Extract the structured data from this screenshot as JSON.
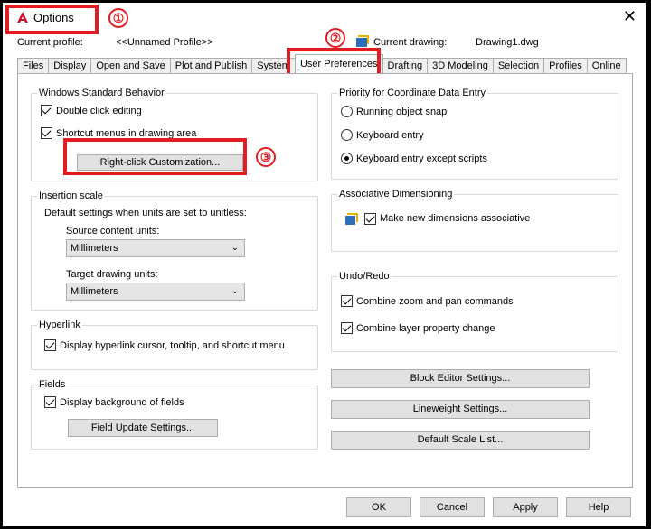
{
  "title": "Options",
  "annotations": {
    "a1": "①",
    "a2": "②",
    "a3": "③"
  },
  "profile": {
    "current_profile_label": "Current profile:",
    "current_profile_value": "<<Unnamed Profile>>",
    "current_drawing_label": "Current drawing:",
    "current_drawing_value": "Drawing1.dwg"
  },
  "tabs": [
    "Files",
    "Display",
    "Open and Save",
    "Plot and Publish",
    "System",
    "User Preferences",
    "Drafting",
    "3D Modeling",
    "Selection",
    "Profiles",
    "Online"
  ],
  "windows_behavior": {
    "label": "Windows Standard Behavior",
    "double_click": "Double click editing",
    "shortcut_menus": "Shortcut menus in drawing area",
    "right_click_button": "Right-click Customization..."
  },
  "insertion_scale": {
    "label": "Insertion scale",
    "description": "Default settings when units are set to unitless:",
    "source_label": "Source content units:",
    "source_value": "Millimeters",
    "target_label": "Target drawing units:",
    "target_value": "Millimeters"
  },
  "hyperlink": {
    "label": "Hyperlink",
    "display": "Display hyperlink cursor, tooltip, and shortcut menu"
  },
  "fields": {
    "label": "Fields",
    "display_background": "Display background of fields",
    "update_button": "Field Update Settings..."
  },
  "priority": {
    "label": "Priority for Coordinate Data Entry",
    "running": "Running object snap",
    "keyboard": "Keyboard entry",
    "keyboard_except": "Keyboard entry except scripts",
    "selected": "keyboard_except"
  },
  "associative": {
    "label": "Associative Dimensioning",
    "make_new": "Make new dimensions associative"
  },
  "undo": {
    "label": "Undo/Redo",
    "combine_zoom": "Combine zoom and pan commands",
    "combine_layer": "Combine layer property change"
  },
  "side_buttons": {
    "block_editor": "Block Editor Settings...",
    "lineweight": "Lineweight Settings...",
    "default_scale": "Default Scale List..."
  },
  "footer": {
    "ok": "OK",
    "cancel": "Cancel",
    "apply": "Apply",
    "help": "Help"
  },
  "colors": {
    "annotation": "#e31b23",
    "autocad_red": "#c8102e"
  }
}
